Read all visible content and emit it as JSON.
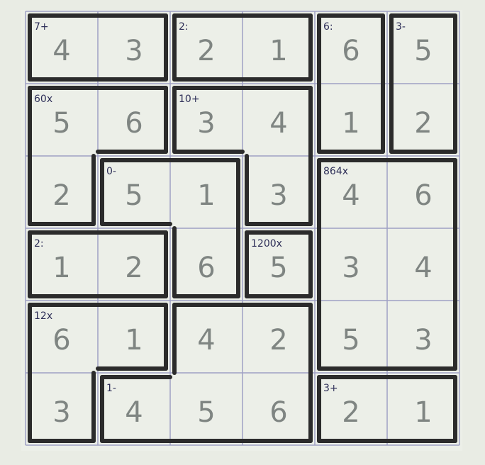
{
  "grid": {
    "size": 6,
    "ink_color": "#2b2b2b",
    "grid_line_color": "#9fa0c4",
    "paper_color": "#ecefe8",
    "digit_color": "#7f8582",
    "clue_color": "#2e2f58"
  },
  "rows": [
    [
      4,
      3,
      2,
      1,
      6,
      5
    ],
    [
      5,
      6,
      3,
      4,
      1,
      2
    ],
    [
      2,
      5,
      1,
      3,
      4,
      6
    ],
    [
      1,
      2,
      6,
      5,
      3,
      4
    ],
    [
      6,
      1,
      4,
      2,
      5,
      3
    ],
    [
      3,
      4,
      5,
      6,
      2,
      1
    ]
  ],
  "cages": [
    {
      "id": 0,
      "clue": "7+"
    },
    {
      "id": 1,
      "clue": "2:"
    },
    {
      "id": 2,
      "clue": "6:"
    },
    {
      "id": 3,
      "clue": "3-"
    },
    {
      "id": 4,
      "clue": "60x"
    },
    {
      "id": 5,
      "clue": "10+"
    },
    {
      "id": 6,
      "clue": "0-"
    },
    {
      "id": 7,
      "clue": "864x"
    },
    {
      "id": 8,
      "clue": "2:"
    },
    {
      "id": 9,
      "clue": "1200x"
    },
    {
      "id": 10,
      "clue": "12x"
    },
    {
      "id": 11,
      "clue": "1-"
    },
    {
      "id": 12,
      "clue": "3+"
    }
  ]
}
